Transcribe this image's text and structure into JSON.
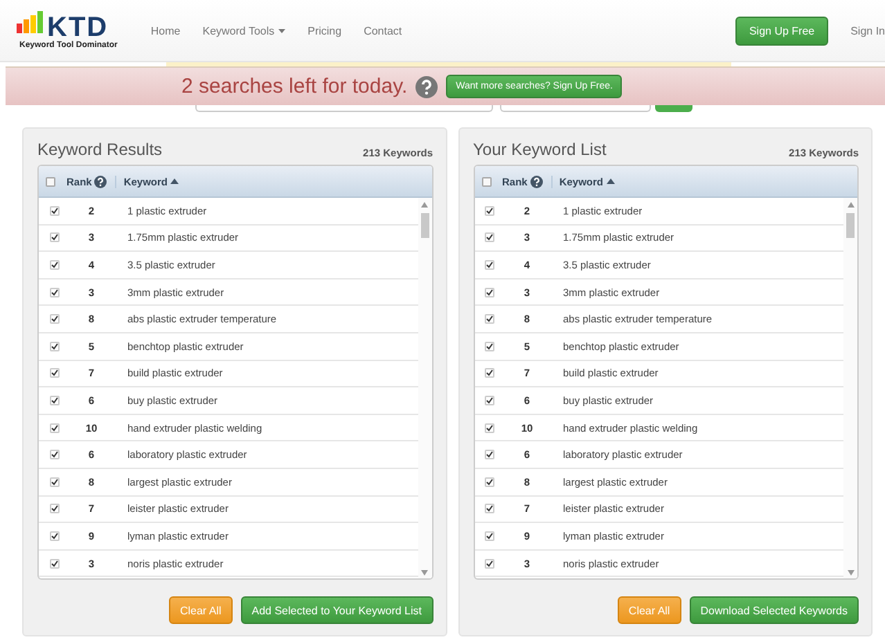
{
  "logo": {
    "name": "KTD",
    "tagline": "Keyword Tool Dominator"
  },
  "nav": [
    {
      "label": "Home",
      "dropdown": false
    },
    {
      "label": "Keyword Tools",
      "dropdown": true
    },
    {
      "label": "Pricing",
      "dropdown": false
    },
    {
      "label": "Contact",
      "dropdown": false
    }
  ],
  "signup_button": "Sign Up Free",
  "signin_link": "Sign In",
  "banner": {
    "message": "2 searches left for today.",
    "button": "Want more searches? Sign Up Free."
  },
  "panels": [
    {
      "title": "Keyword Results",
      "count": "213 Keywords",
      "all_checked": false,
      "columns": [
        "Rank",
        "Keyword"
      ],
      "buttons": [
        {
          "label": "Clear All",
          "kind": "warning"
        },
        {
          "label": "Add Selected to Your Keyword List",
          "kind": "success"
        }
      ],
      "rows": [
        {
          "checked": true,
          "rank": "2",
          "keyword": "1 plastic extruder"
        },
        {
          "checked": true,
          "rank": "3",
          "keyword": "1.75mm plastic extruder"
        },
        {
          "checked": true,
          "rank": "4",
          "keyword": "3.5 plastic extruder"
        },
        {
          "checked": true,
          "rank": "3",
          "keyword": "3mm plastic extruder"
        },
        {
          "checked": true,
          "rank": "8",
          "keyword": "abs plastic extruder temperature"
        },
        {
          "checked": true,
          "rank": "5",
          "keyword": "benchtop plastic extruder"
        },
        {
          "checked": true,
          "rank": "7",
          "keyword": "build plastic extruder"
        },
        {
          "checked": true,
          "rank": "6",
          "keyword": "buy plastic extruder"
        },
        {
          "checked": true,
          "rank": "10",
          "keyword": "hand extruder plastic welding"
        },
        {
          "checked": true,
          "rank": "6",
          "keyword": "laboratory plastic extruder"
        },
        {
          "checked": true,
          "rank": "8",
          "keyword": "largest plastic extruder"
        },
        {
          "checked": true,
          "rank": "7",
          "keyword": "leister plastic extruder"
        },
        {
          "checked": true,
          "rank": "9",
          "keyword": "lyman plastic extruder"
        },
        {
          "checked": true,
          "rank": "3",
          "keyword": "noris plastic extruder"
        }
      ]
    },
    {
      "title": "Your Keyword List",
      "count": "213 Keywords",
      "all_checked": false,
      "columns": [
        "Rank",
        "Keyword"
      ],
      "buttons": [
        {
          "label": "Clear All",
          "kind": "warning"
        },
        {
          "label": "Download Selected Keywords",
          "kind": "success"
        }
      ],
      "rows": [
        {
          "checked": true,
          "rank": "2",
          "keyword": "1 plastic extruder"
        },
        {
          "checked": true,
          "rank": "3",
          "keyword": "1.75mm plastic extruder"
        },
        {
          "checked": true,
          "rank": "4",
          "keyword": "3.5 plastic extruder"
        },
        {
          "checked": true,
          "rank": "3",
          "keyword": "3mm plastic extruder"
        },
        {
          "checked": true,
          "rank": "8",
          "keyword": "abs plastic extruder temperature"
        },
        {
          "checked": true,
          "rank": "5",
          "keyword": "benchtop plastic extruder"
        },
        {
          "checked": true,
          "rank": "7",
          "keyword": "build plastic extruder"
        },
        {
          "checked": true,
          "rank": "6",
          "keyword": "buy plastic extruder"
        },
        {
          "checked": true,
          "rank": "10",
          "keyword": "hand extruder plastic welding"
        },
        {
          "checked": true,
          "rank": "6",
          "keyword": "laboratory plastic extruder"
        },
        {
          "checked": true,
          "rank": "8",
          "keyword": "largest plastic extruder"
        },
        {
          "checked": true,
          "rank": "7",
          "keyword": "leister plastic extruder"
        },
        {
          "checked": true,
          "rank": "9",
          "keyword": "lyman plastic extruder"
        },
        {
          "checked": true,
          "rank": "3",
          "keyword": "noris plastic extruder"
        }
      ]
    }
  ]
}
